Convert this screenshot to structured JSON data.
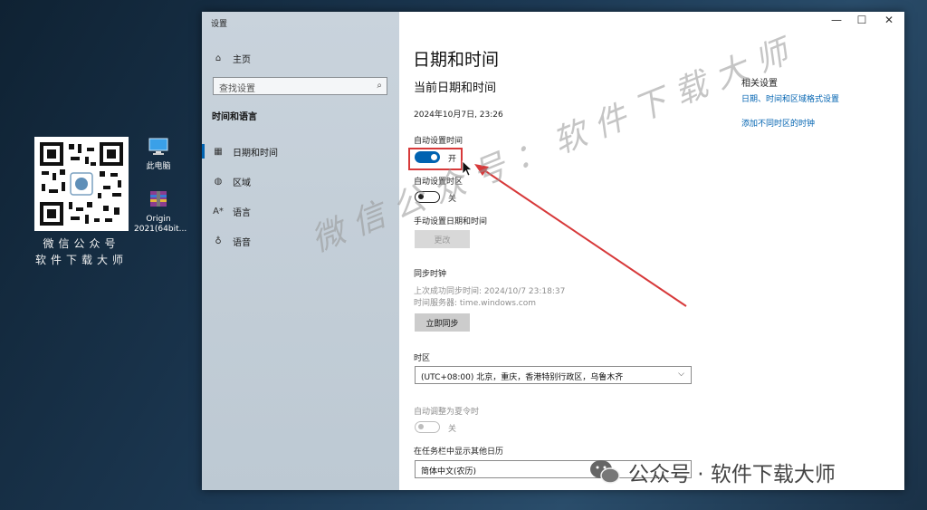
{
  "desktop": {
    "qr_caption_1": "微信公众号",
    "qr_caption_2": "软件下载大师",
    "icons": [
      {
        "label": "此电脑"
      },
      {
        "label": "Origin 2021(64bit..."
      }
    ]
  },
  "window": {
    "title": "设置",
    "controls": {
      "minimize": "—",
      "maximize": "☐",
      "close": "✕"
    }
  },
  "sidebar": {
    "home": "主页",
    "search_placeholder": "查找设置",
    "section": "时间和语言",
    "items": [
      {
        "label": "日期和时间",
        "icon": "calendar-clock-icon"
      },
      {
        "label": "区域",
        "icon": "globe-icon"
      },
      {
        "label": "语言",
        "icon": "language-icon"
      },
      {
        "label": "语音",
        "icon": "microphone-icon"
      }
    ]
  },
  "main": {
    "title": "日期和时间",
    "subtitle": "当前日期和时间",
    "current_datetime": "2024年10月7日, 23:26",
    "auto_time_label": "自动设置时间",
    "auto_time_state": "开",
    "auto_zone_label": "自动设置时区",
    "auto_zone_state": "关",
    "manual_label": "手动设置日期和时间",
    "change_button": "更改",
    "sync_label": "同步时钟",
    "last_sync": "上次成功同步时间: 2024/10/7 23:18:37",
    "time_server": "时间服务器: time.windows.com",
    "sync_button": "立即同步",
    "timezone_label": "时区",
    "timezone_value": "(UTC+08:00) 北京，重庆，香港特别行政区，乌鲁木齐",
    "dst_label": "自动调整为夏令时",
    "dst_state": "关",
    "calendar_label": "在任务栏中显示其他日历",
    "calendar_value": "简体中文(农历)"
  },
  "related": {
    "title": "相关设置",
    "link1": "日期、时间和区域格式设置",
    "link2": "添加不同时区的时钟"
  },
  "watermark": "微信公众号：软件下载大师",
  "brand": "公众号 · 软件下载大师",
  "colors": {
    "accent": "#0063b1",
    "highlight": "#d7393a"
  }
}
